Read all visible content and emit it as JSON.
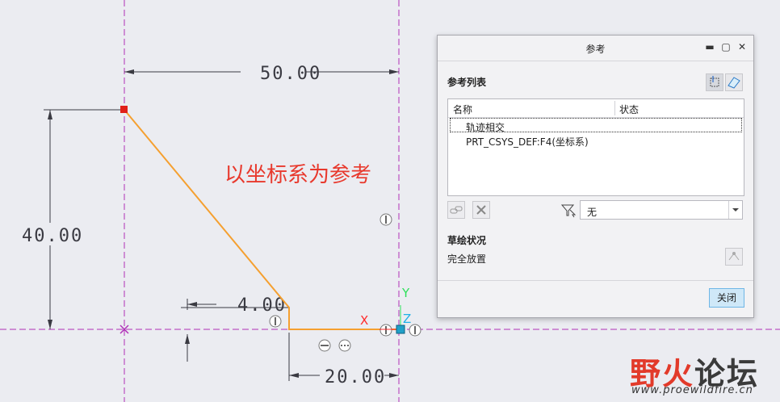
{
  "sketch": {
    "dim_width_top": "50.00",
    "dim_height_left": "40.00",
    "dim_step": "4.00",
    "dim_width_bottom": "20.00",
    "axis_x_label": "X",
    "axis_y_label": "Y",
    "axis_z_label": "Z",
    "annotation": "以坐标系为参考",
    "colors": {
      "centerline": "#b02fb8",
      "geometry": "#f5a030",
      "dimension": "#3a3a42",
      "annotation": "#e8392d",
      "x_axis": "#ff2a2a",
      "y_axis": "#2ee05a",
      "z_axis": "#1fb0e8"
    }
  },
  "dialog": {
    "title": "参考",
    "section_refs": "参考列表",
    "col_name": "名称",
    "col_status": "状态",
    "items": [
      {
        "name": "轨迹相交",
        "status": ""
      },
      {
        "name": "PRT_CSYS_DEF:F4(坐标系)",
        "status": ""
      }
    ],
    "filter_value": "无",
    "section_status": "草绘状况",
    "status_text": "完全放置",
    "close_label": "关闭"
  },
  "watermark": {
    "text_a": "野火",
    "text_b": "论坛",
    "url": "www.proewildfire.cn"
  }
}
